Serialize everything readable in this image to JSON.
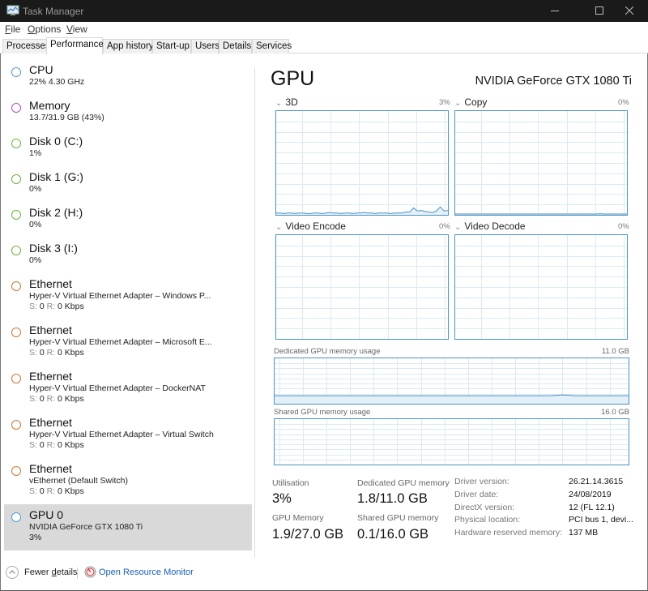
{
  "window": {
    "title": "Task Manager",
    "controls": {
      "minimize": "minimize",
      "maximize": "maximize",
      "close": "close"
    }
  },
  "menu": [
    {
      "label": "File",
      "accel": "F",
      "rest": "ile"
    },
    {
      "label": "Options",
      "accel": "O",
      "rest": "ptions"
    },
    {
      "label": "View",
      "accel": "V",
      "rest": "iew"
    }
  ],
  "tabs": [
    {
      "label": "Processes",
      "active": false
    },
    {
      "label": "Performance",
      "active": true
    },
    {
      "label": "App history",
      "active": false
    },
    {
      "label": "Start-up",
      "active": false
    },
    {
      "label": "Users",
      "active": false
    },
    {
      "label": "Details",
      "active": false
    },
    {
      "label": "Services",
      "active": false
    }
  ],
  "sidebar": {
    "items": [
      {
        "title": "CPU",
        "line1": "22%  4.30 GHz",
        "color": "#4f9bd1"
      },
      {
        "title": "Memory",
        "line1": "13.7/31.9 GB (43%)",
        "color": "#b04fc2"
      },
      {
        "title": "Disk 0 (C:)",
        "line1": "1%",
        "color": "#6db33f"
      },
      {
        "title": "Disk 1 (G:)",
        "line1": "0%",
        "color": "#6db33f"
      },
      {
        "title": "Disk 2 (H:)",
        "line1": "0%",
        "color": "#6db33f"
      },
      {
        "title": "Disk 3 (I:)",
        "line1": "0%",
        "color": "#6db33f"
      },
      {
        "title": "Ethernet",
        "line1": "Hyper-V Virtual Ethernet Adapter – Windows P...",
        "s_label": "S:",
        "s_value": "0",
        "r_label": "R:",
        "r_value": "0 Kbps",
        "color": "#c9773a"
      },
      {
        "title": "Ethernet",
        "line1": "Hyper-V Virtual Ethernet Adapter – Microsoft E...",
        "s_label": "S:",
        "s_value": "0",
        "r_label": "R:",
        "r_value": "0 Kbps",
        "color": "#c9773a"
      },
      {
        "title": "Ethernet",
        "line1": "Hyper-V Virtual Ethernet Adapter – DockerNAT",
        "s_label": "S:",
        "s_value": "0",
        "r_label": "R:",
        "r_value": "0 Kbps",
        "color": "#c9773a"
      },
      {
        "title": "Ethernet",
        "line1": "Hyper-V Virtual Ethernet Adapter – Virtual Switch",
        "s_label": "S:",
        "s_value": "0",
        "r_label": "R:",
        "r_value": "0 Kbps",
        "color": "#c9773a"
      },
      {
        "title": "Ethernet",
        "line1": "vEthernet (Default Switch)",
        "s_label": "S:",
        "s_value": "0",
        "r_label": "R:",
        "r_value": "0 Kbps",
        "color": "#c9773a"
      },
      {
        "title": "GPU 0",
        "line1": "NVIDIA GeForce GTX 1080 Ti",
        "line2": "3%",
        "color": "#4f9bd1",
        "selected": true
      }
    ]
  },
  "main": {
    "title": "GPU",
    "model": "NVIDIA GeForce GTX 1080 Ti",
    "engines": [
      {
        "label": "3D",
        "percent": "3%",
        "history": [
          1,
          1,
          0.5,
          1,
          1,
          0.5,
          1,
          1,
          0.5,
          0.5,
          1,
          1,
          0.5,
          1,
          1.5,
          1,
          1,
          0.5,
          1,
          1,
          0.5,
          1,
          1,
          1.5,
          1,
          1,
          0.5,
          1,
          1,
          1,
          0.5,
          1,
          1,
          1,
          2,
          2,
          6,
          3,
          3.5,
          2.5,
          2,
          1.5,
          3,
          7,
          3,
          3.5
        ]
      },
      {
        "label": "Copy",
        "percent": "0%",
        "history": [
          0,
          0,
          0,
          0,
          0,
          0,
          0,
          0,
          0,
          0,
          0,
          0,
          0,
          0,
          0,
          0,
          0,
          0,
          0,
          0,
          0,
          0,
          0,
          0,
          0,
          0,
          0,
          0,
          0,
          0,
          0,
          0,
          0,
          0,
          0,
          0,
          0,
          0,
          0.3,
          0,
          0,
          0,
          0,
          0,
          0,
          0
        ]
      },
      {
        "label": "Video Encode",
        "percent": "0%",
        "history": []
      },
      {
        "label": "Video Decode",
        "percent": "0%",
        "history": []
      }
    ],
    "dedicated_memory_graph": {
      "label": "Dedicated GPU memory usage",
      "max": "11.0 GB",
      "history_gb": [
        1.8,
        1.8,
        1.8,
        1.8,
        1.8,
        1.8,
        1.8,
        1.8,
        1.8,
        1.8,
        1.8,
        1.8,
        1.8,
        1.8,
        1.8,
        1.8,
        1.8,
        1.8,
        1.8,
        1.8,
        1.8,
        1.8,
        1.8,
        1.8,
        1.8,
        1.8,
        1.8,
        1.8,
        1.8,
        1.8,
        1.8,
        1.8,
        1.8,
        1.8,
        1.8,
        1.8,
        1.8,
        1.8,
        1.8,
        1.8,
        1.8,
        1.8,
        1.8,
        1.8,
        1.8,
        1.8,
        1.8,
        1.9,
        2.0,
        1.9,
        1.8,
        1.8,
        1.8,
        1.8,
        1.8,
        1.8,
        1.8,
        1.8,
        1.8,
        1.8
      ]
    },
    "shared_memory_graph": {
      "label": "Shared GPU memory usage",
      "max": "16.0 GB",
      "history_gb": []
    },
    "stats": {
      "utilisation": {
        "label": "Utilisation",
        "value": "3%"
      },
      "dedicated": {
        "label": "Dedicated GPU memory",
        "value": "1.8/11.0 GB"
      },
      "gpu_memory": {
        "label": "GPU Memory",
        "value": "1.9/27.0 GB"
      },
      "shared": {
        "label": "Shared GPU memory",
        "value": "0.1/16.0 GB"
      }
    },
    "info": [
      {
        "label": "Driver version:",
        "value": "26.21.14.3615"
      },
      {
        "label": "Driver date:",
        "value": "24/08/2019"
      },
      {
        "label": "DirectX version:",
        "value": "12 (FL 12.1)"
      },
      {
        "label": "Physical location:",
        "value": "PCI bus 1, devi..."
      },
      {
        "label": "Hardware reserved memory:",
        "value": "137 MB"
      }
    ]
  },
  "footer": {
    "fewer_details_pre": "Fewer ",
    "fewer_details_accel": "d",
    "fewer_details_post": "etails",
    "open_resource_monitor": "Open Resource Monitor"
  },
  "colors": {
    "graph_border": "#4b92c3",
    "graph_grid": "#d9eaf5",
    "graph_line": "#4b92c3",
    "graph_fill": "#e3f0f9",
    "selected_bg": "#d9d9d9",
    "link": "#1a5fb4"
  }
}
